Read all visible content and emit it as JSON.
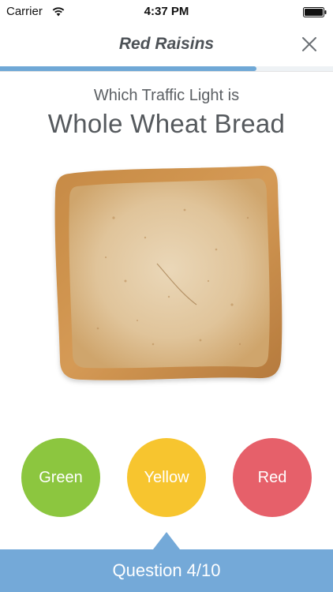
{
  "status_bar": {
    "carrier": "Carrier",
    "time": "4:37 PM"
  },
  "nav": {
    "title": "Red Raisins"
  },
  "progress": {
    "fraction": 0.77,
    "color": "#6fa8d6"
  },
  "question": {
    "prompt": "Which Traffic Light is",
    "food_name": "Whole Wheat Bread"
  },
  "answers": [
    {
      "label": "Green",
      "color": "#8cc63f"
    },
    {
      "label": "Yellow",
      "color": "#f7c52f"
    },
    {
      "label": "Red",
      "color": "#e6606a"
    }
  ],
  "footer": {
    "label": "Question 4/10",
    "color": "#74a9d8"
  },
  "icons": {
    "wifi": "wifi-icon",
    "battery": "battery-icon",
    "close": "close-icon"
  }
}
